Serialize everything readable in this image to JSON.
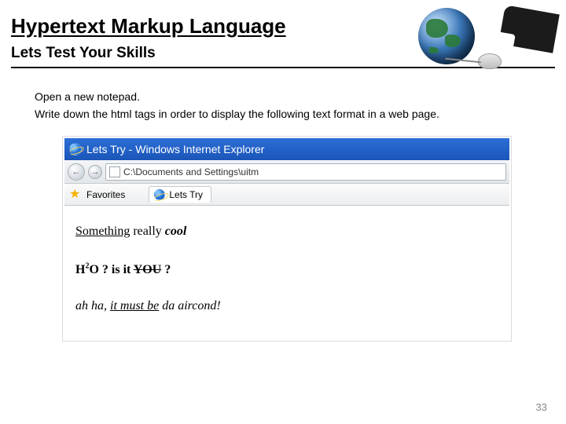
{
  "slide": {
    "title": "Hypertext Markup Language",
    "subtitle": "Lets Test Your Skills",
    "instructions": {
      "line1": "Open a new notepad.",
      "line2": "Write down the html tags in order to display the following text format in a web page."
    },
    "pagenum": "33"
  },
  "browser": {
    "window_title": "Lets Try - Windows Internet Explorer",
    "address": "C:\\Documents and Settings\\uitm",
    "favorites_label": "Favorites",
    "tab_label": "Lets Try",
    "icons": {
      "app": "ie-icon",
      "back": "←",
      "forward": "→",
      "star": "★"
    },
    "content": {
      "line1_a": "Something",
      "line1_b": " really ",
      "line1_c": "cool",
      "line2_a": "H",
      "line2_sup": "2",
      "line2_b": "O ? is it ",
      "line2_you": "YOU",
      "line2_c": " ?",
      "line3_a": "ah ha, ",
      "line3_must": "it must be",
      "line3_b": " da aircond!"
    }
  }
}
